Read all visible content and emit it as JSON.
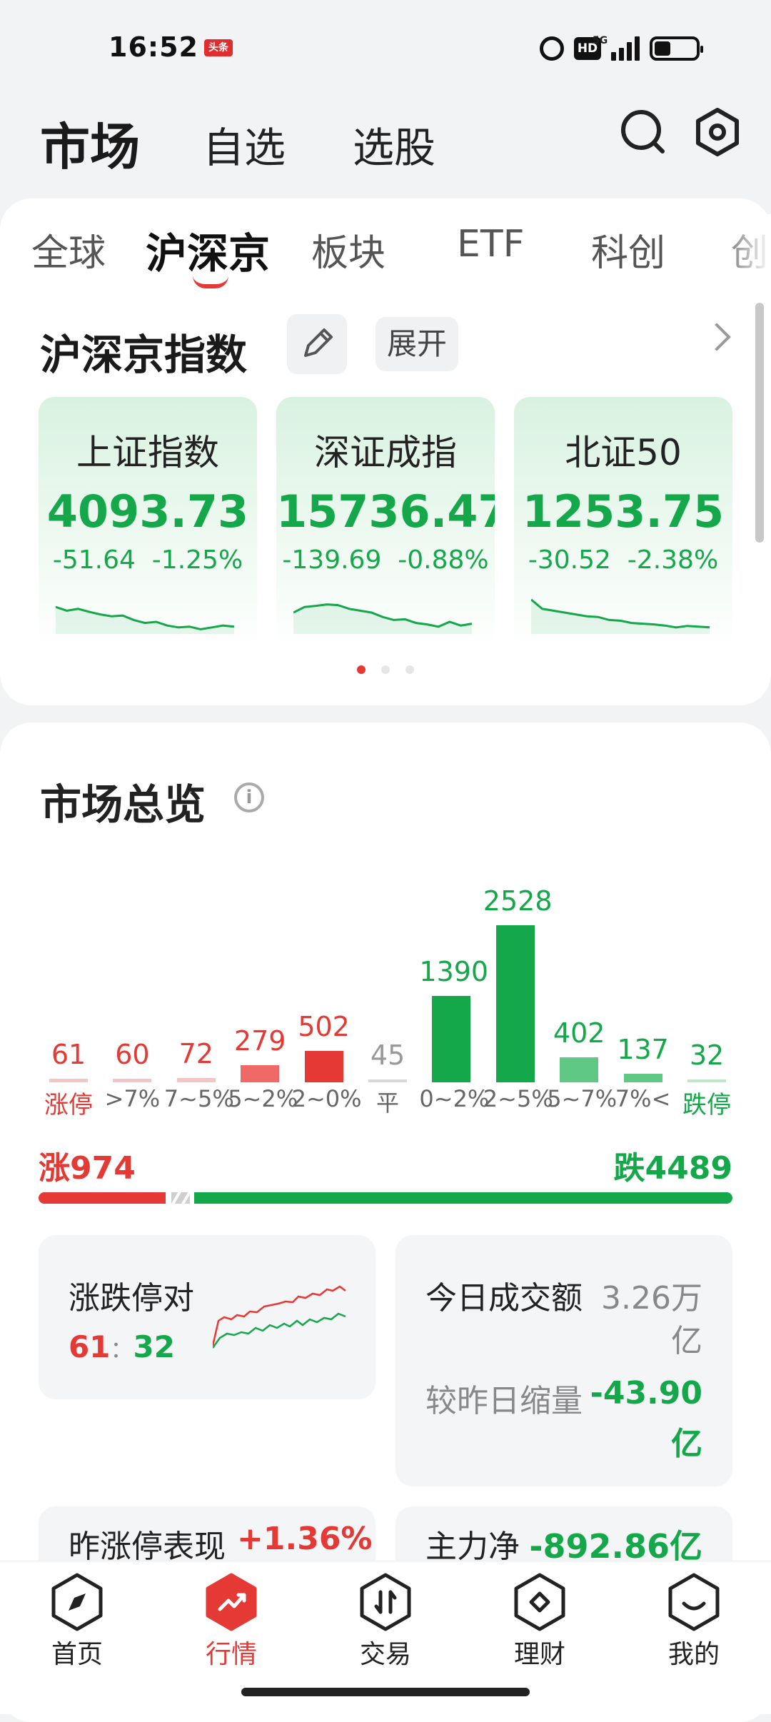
{
  "status": {
    "time": "16:52",
    "badge": "头条",
    "hd": "HD",
    "network": "5G"
  },
  "header": {
    "title": "市场",
    "tabs": [
      "自选",
      "选股"
    ]
  },
  "subtabs": [
    "全球",
    "沪深京",
    "板块",
    "ETF",
    "科创",
    "创"
  ],
  "indices_section": {
    "title": "沪深京指数",
    "expand_label": "展开",
    "cards": [
      {
        "name": "上证指数",
        "value": "4093.73",
        "change": "-51.64",
        "pct": "-1.25%",
        "trend": [
          0.35,
          0.45,
          0.4,
          0.48,
          0.55,
          0.6,
          0.58,
          0.7,
          0.78,
          0.75,
          0.85,
          0.9,
          0.88,
          0.95,
          0.9,
          0.85,
          0.88
        ]
      },
      {
        "name": "深证成指",
        "value": "15736.47",
        "change": "-139.69",
        "pct": "-0.88%",
        "trend": [
          0.5,
          0.35,
          0.32,
          0.28,
          0.3,
          0.4,
          0.45,
          0.5,
          0.62,
          0.7,
          0.68,
          0.78,
          0.82,
          0.88,
          0.75,
          0.85,
          0.8
        ]
      },
      {
        "name": "北证50",
        "value": "1253.75",
        "change": "-30.52",
        "pct": "-2.38%",
        "trend": [
          0.15,
          0.4,
          0.45,
          0.5,
          0.55,
          0.6,
          0.62,
          0.7,
          0.72,
          0.78,
          0.8,
          0.82,
          0.85,
          0.9,
          0.86,
          0.88,
          0.9
        ]
      }
    ],
    "active_page": 0,
    "pages": 3
  },
  "overview": {
    "title": "市场总览",
    "distribution": [
      {
        "label": "涨停",
        "value": 61,
        "color": "#e53935"
      },
      {
        "label": ">7%",
        "value": 60,
        "color": "#e53935"
      },
      {
        "label": "7~5%",
        "value": 72,
        "color": "#e53935"
      },
      {
        "label": "5~2%",
        "value": 279,
        "color": "#e53935"
      },
      {
        "label": "2~0%",
        "value": 502,
        "color": "#e53935"
      },
      {
        "label": "平",
        "value": 45,
        "color": "#999999"
      },
      {
        "label": "0~2%",
        "value": 1390,
        "color": "#15a84a"
      },
      {
        "label": "2~5%",
        "value": 2528,
        "color": "#15a84a"
      },
      {
        "label": "5~7%",
        "value": 402,
        "color": "#15a84a"
      },
      {
        "label": "7%<",
        "value": 137,
        "color": "#15a84a"
      },
      {
        "label": "跌停",
        "value": 32,
        "color": "#15a84a"
      }
    ],
    "up_label": "涨974",
    "down_label": "跌4489",
    "limit_pair": {
      "title": "涨跌停对",
      "up": "61",
      "sep": "：",
      "down": "32"
    },
    "turnover": {
      "title": "今日成交额",
      "value": "3.26万",
      "unit": "亿",
      "compare_label": "较昨日缩量",
      "compare_value": "-43.90",
      "compare_unit": "亿"
    },
    "yesterday_limit": {
      "title": "昨涨停表现",
      "value": "+1.36%"
    },
    "main_net": {
      "title": "主力净",
      "value": "-892.86亿"
    }
  },
  "bottom_nav": [
    {
      "label": "首页"
    },
    {
      "label": "行情"
    },
    {
      "label": "交易"
    },
    {
      "label": "理财"
    },
    {
      "label": "我的"
    }
  ],
  "colors": {
    "up": "#e53935",
    "down": "#15a84a",
    "flat": "#999999"
  }
}
